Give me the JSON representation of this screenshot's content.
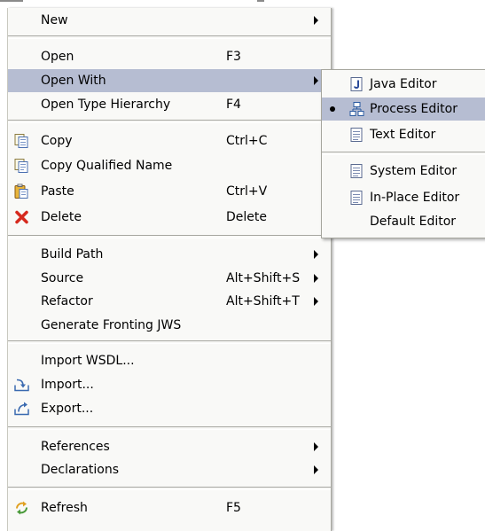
{
  "context_menu": {
    "items": [
      {
        "label": "New",
        "submenu": true
      },
      {
        "label": "Open",
        "shortcut": "F3"
      },
      {
        "label": "Open With",
        "submenu": true,
        "highlighted": true
      },
      {
        "label": "Open Type Hierarchy",
        "shortcut": "F4"
      },
      {
        "label": "Copy",
        "shortcut": "Ctrl+C",
        "icon": "copy-icon"
      },
      {
        "label": "Copy Qualified Name",
        "icon": "copy-qualified-name-icon"
      },
      {
        "label": "Paste",
        "shortcut": "Ctrl+V",
        "icon": "paste-icon"
      },
      {
        "label": "Delete",
        "shortcut": "Delete",
        "icon": "delete-icon"
      },
      {
        "label": "Build Path",
        "submenu": true
      },
      {
        "label": "Source",
        "shortcut": "Alt+Shift+S",
        "submenu": true
      },
      {
        "label": "Refactor",
        "shortcut": "Alt+Shift+T",
        "submenu": true
      },
      {
        "label": "Generate Fronting JWS"
      },
      {
        "label": "Import WSDL..."
      },
      {
        "label": "Import...",
        "icon": "import-icon"
      },
      {
        "label": "Export...",
        "icon": "export-icon"
      },
      {
        "label": "References",
        "submenu": true
      },
      {
        "label": "Declarations",
        "submenu": true
      },
      {
        "label": "Refresh",
        "shortcut": "F5",
        "icon": "refresh-icon"
      }
    ]
  },
  "open_with_submenu": {
    "items": [
      {
        "label": "Java Editor",
        "icon": "java-editor-icon"
      },
      {
        "label": "Process Editor",
        "icon": "process-editor-icon",
        "selected": true,
        "highlighted": true
      },
      {
        "label": "Text Editor",
        "icon": "text-editor-icon"
      },
      {
        "label": "System Editor",
        "icon": "system-editor-icon"
      },
      {
        "label": "In-Place Editor",
        "icon": "in-place-editor-icon"
      },
      {
        "label": "Default Editor"
      }
    ]
  },
  "colors": {
    "menu_background": "#f9f9f7",
    "highlight": "#b6bdd2",
    "separator": "#a6a6a0",
    "delete_icon": "#d62a1e"
  }
}
